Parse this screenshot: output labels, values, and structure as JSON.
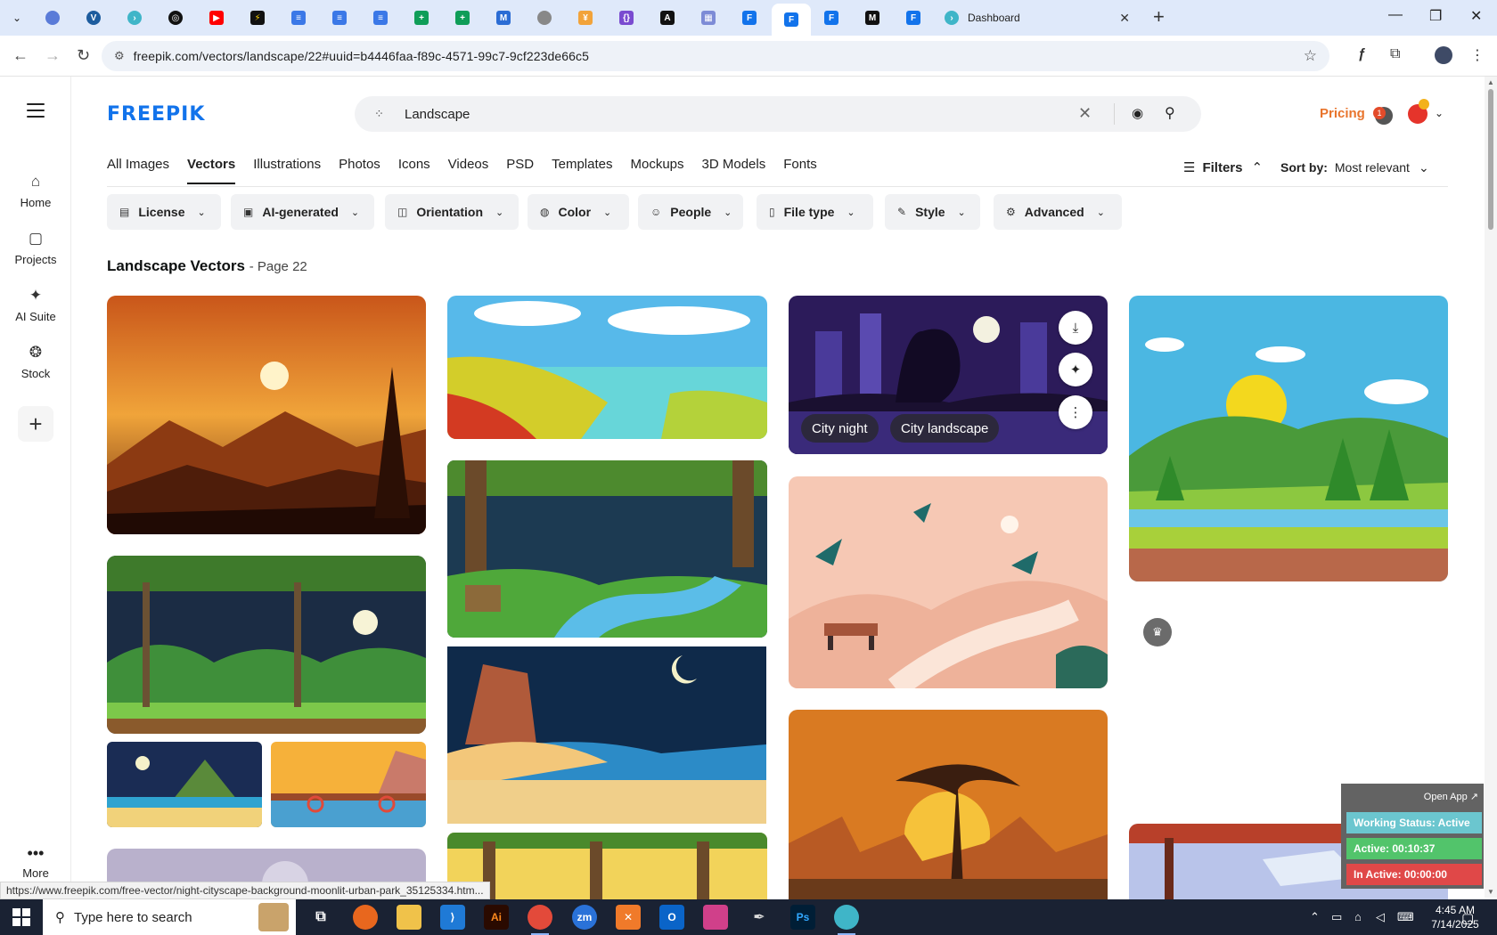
{
  "browser": {
    "active_tab_title": "Dashboard",
    "url": "freepik.com/vectors/landscape/22#uuid=b4446faa-f89c-4571-99c7-9cf223de66c5",
    "status_url": "https://www.freepik.com/free-vector/night-cityscape-background-moonlit-urban-park_35125334.htm..."
  },
  "rail": {
    "items": [
      {
        "label": "Home"
      },
      {
        "label": "Projects"
      },
      {
        "label": "AI Suite"
      },
      {
        "label": "Stock"
      }
    ],
    "more_label": "More"
  },
  "header": {
    "logo": "FREEPIK",
    "search_value": "Landscape",
    "pricing": "Pricing",
    "notifications": "1"
  },
  "categories": [
    "All Images",
    "Vectors",
    "Illustrations",
    "Photos",
    "Icons",
    "Videos",
    "PSD",
    "Templates",
    "Mockups",
    "3D Models",
    "Fonts"
  ],
  "filters_label": "Filters",
  "sort": {
    "label": "Sort by:",
    "value": "Most relevant"
  },
  "chips": [
    "License",
    "AI-generated",
    "Orientation",
    "Color",
    "People",
    "File type",
    "Style",
    "Advanced"
  ],
  "heading": {
    "title": "Landscape Vectors",
    "page": "- Page 22"
  },
  "hover_tags": [
    "City night",
    "City landscape"
  ],
  "time_widget": {
    "open_app": "Open App ↗",
    "working_status": "Working Status: Active",
    "active": "Active: 00:10:37",
    "inactive": "In Active: 00:00:00"
  },
  "taskbar": {
    "search_placeholder": "Type here to search",
    "time": "4:45 AM",
    "date": "7/14/2025"
  },
  "colors": {
    "brand_blue": "#1273eb",
    "pricing_orange": "#e8742c",
    "widget_active": "#52c46b",
    "widget_inactive": "#e04848",
    "widget_status": "#6bc6cf"
  }
}
